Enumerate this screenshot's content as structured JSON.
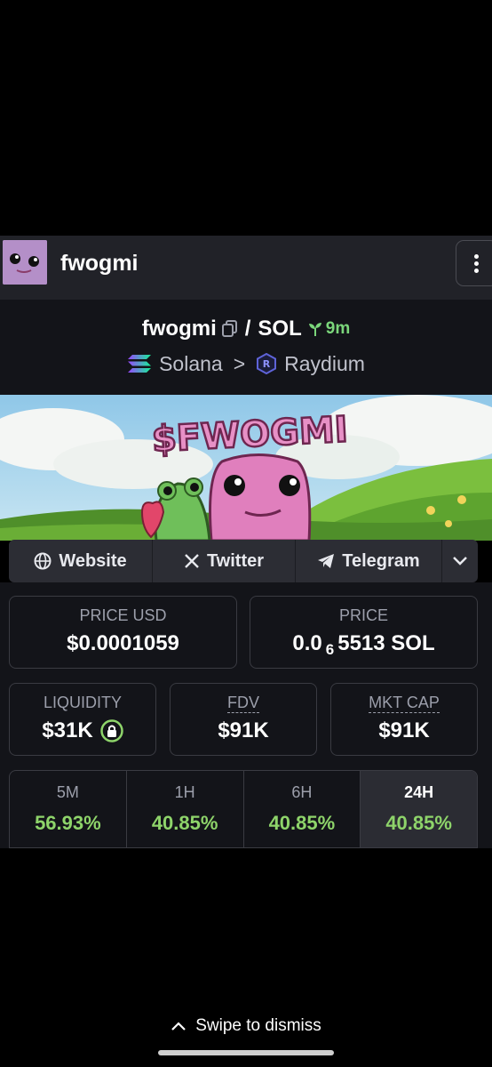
{
  "topbar": {
    "title": "fwogmi"
  },
  "pair": {
    "base": "fwogmi",
    "slash": "/",
    "quote": "SOL",
    "age": "9m",
    "chain": "Solana",
    "separator": ">",
    "dex": "Raydium"
  },
  "banner": {
    "title": "$FWOGMI"
  },
  "social": {
    "website": "Website",
    "twitter": "Twitter",
    "telegram": "Telegram"
  },
  "stats": {
    "price_usd_label": "PRICE USD",
    "price_usd": "$0.0001059",
    "price_label": "PRICE",
    "price_prefix": "0.0",
    "price_zeros": "6",
    "price_digits": "5513 SOL",
    "liquidity_label": "LIQUIDITY",
    "liquidity": "$31K",
    "fdv_label": "FDV",
    "fdv": "$91K",
    "mktcap_label": "MKT CAP",
    "mktcap": "$91K"
  },
  "changes": [
    {
      "label": "5M",
      "value": "56.93%"
    },
    {
      "label": "1H",
      "value": "40.85%"
    },
    {
      "label": "6H",
      "value": "40.85%"
    },
    {
      "label": "24H",
      "value": "40.85%"
    }
  ],
  "dismiss": {
    "label": "Swipe to dismiss"
  },
  "colors": {
    "positive": "#8ed46a",
    "age": "#7bd67b",
    "panel": "#131419",
    "avatar": "#b48fc8"
  }
}
